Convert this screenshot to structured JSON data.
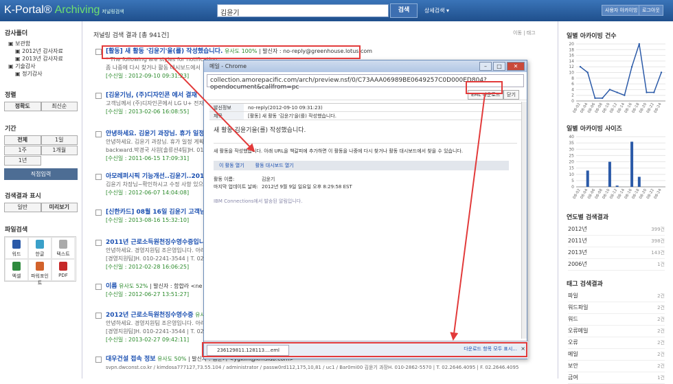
{
  "header": {
    "logo_kportal": "K-Portal®",
    "logo_archiving": "Archiving",
    "logo_sub": "저널링검색",
    "search_value": "김윤기",
    "search_button": "검색",
    "advanced_search": "상세검색 ▾",
    "my_archiving": "사용자 아카이빙",
    "logout": "로그아웃"
  },
  "left": {
    "audit_folder_title": "감사폴더",
    "tree": [
      "보관함",
      "2012년 감사자료",
      "2013년 감사자료",
      "기술감사",
      "정기감사"
    ],
    "sort_title": "정렬",
    "sort_options": [
      "정확도",
      "최신순"
    ],
    "period_title": "기간",
    "period_options": [
      "전체",
      "1일",
      "1주",
      "1개월",
      "1년"
    ],
    "direct_input": "직접입력",
    "display_title": "검색결과 표시",
    "display_options": [
      "일반",
      "미리보기"
    ],
    "file_search_title": "파일검색",
    "file_types": [
      "워드",
      "한글",
      "텍스트",
      "엑셀",
      "파워포인트",
      "PDF"
    ]
  },
  "main": {
    "title": "저널링 검색 결과",
    "count": "[총 941건]",
    "tool_move": "이동",
    "tool_tag": "태그",
    "results": [
      {
        "title": "[활동] 새 활동 '김윤기'을(를) 작성했습니다.",
        "sim": "유사도 100%",
        "sender": "발신자 : no-reply@greenhouse.lotus.com",
        "body": "* The following are styles for notification",
        "body2": "좀 나중에 다시 찾거나 활동 대시보드에서",
        "meta": "[수신일 : 2012-09-10 09:31:23]"
      },
      {
        "title": "[김윤기님, (주)디자인콘 에서 결재",
        "sim": "",
        "sender": "",
        "body": "고객님께서 (주)디자인콘에서 LG U+ 전자결",
        "body2": "",
        "meta": "[수신일 : 2013-02-06 16:08:55]"
      },
      {
        "title": "안녕하세요. 김윤기 과장님. 휴가 일정",
        "sim": "",
        "sender": "",
        "body": "안녕하세요. 김윤기 과장님. 휴가 일정 게획",
        "body2": "backward.박경국 사원[솔류션4팀]H. 010-",
        "meta": "[수신일 : 2011-06-15 17:09:31]"
      },
      {
        "title": "아모레퍼시픽 기능개선..김윤기..201206",
        "sim": "",
        "sender": "",
        "body": "김윤기 차장님~확인하시고 수정 사항 있으",
        "body2": "",
        "meta": "[수신일 : 2012-06-07 14:04:08]"
      },
      {
        "title": "[신한카드] 08월 16일 김윤기 고객님께",
        "sim": "",
        "sender": "",
        "body": "",
        "body2": "",
        "meta": "[수신일 : 2013-08-16 15:32:10]"
      },
      {
        "title": "2011년 근로소득원천징수영수증입니다.",
        "sim": "",
        "sender": "",
        "body": "안녕하세요. 경영지원팀 조은영입니다. 아래",
        "body2": "[경영지원팀]H. 010-2241-3544 | T. 02.264",
        "meta": "[수신일 : 2012-02-28 16:06:25]"
      },
      {
        "title": "이름",
        "sim": "유사도 52%",
        "sender": "발신자 : 함합라 <ne",
        "body": "",
        "body2": "",
        "meta": "[수신일 : 2012-06-27 13:51:27]"
      },
      {
        "title": "2012년 근로소득원천징수영수증",
        "sim": "유사",
        "sender": "",
        "body": "안녕하세요. 경영지원팀 조은영입니다. 아래",
        "body2": "[경영지원팀]H. 010-2241-3544 | T. 02.264",
        "meta": "[수신일 : 2013-02-27 09:42:11]"
      },
      {
        "title": "대우건설 접속 정보",
        "sim": "유사도 50%",
        "sender": "발신자 : 김윤기 <ygkim@kmslab.com>",
        "body": "svpn.dwconst.co.kr / kimdosa777127,73.55.104 / administrator / passw0rd112,175,10,81 / uc1 / Bar0mi00 김윤기 과장H. 010-2862-5570 | T. 02.2646.4095 | F. 02.2646.4095",
        "body2": "",
        "meta": ""
      }
    ]
  },
  "popup": {
    "title": "메일 - Chrome",
    "address": "collection.amorepacific.com/arch/preview.nsf/0/C73AAA06989BE0649257C0D000ED804?opendocument&callfrom=pc",
    "eml_download": "EML 다운로드",
    "close": "닫기",
    "sender_label": "발신정보",
    "sender_value": "no-reply(2012-09-10 09:31:23)",
    "subject_label": "제목",
    "subject_value": "[활동] 새 활동 '김윤기'을(를) 작성했습니다.",
    "headline": "새 활동 김윤기을(를) 작성했습니다.",
    "paragraph": "새 활동을 작성했습니다. 아래 URL을 책갈피에 추가하면 이 활동을 나중에 다시 찾거나 활동 대시보드에서 찾을 수 있습니다.",
    "tab_open": "이 활동 열기",
    "tab_dashboard": "활동 대시보드 열기",
    "activity_name_label": "활동 이름:",
    "activity_name_value": "김윤기",
    "last_update_label": "마지막 업데이트 날짜:",
    "last_update_value": "2012년 9월 9일 일요일 오후 8:29:58 EST",
    "footer_link": "IBM Connections에서 발송된 알림입니다.",
    "download_file": "236129811.128113....eml",
    "download_all": "다운로드 항목 모두 표시...",
    "download_close": "×"
  },
  "right": {
    "chart1_title": "일별 아카이빙 건수",
    "chart2_title": "일별 아카이빙 사이즈",
    "year_title": "연도별 검색결과",
    "years": [
      {
        "label": "2012년",
        "count": "399건"
      },
      {
        "label": "2011년",
        "count": "398건"
      },
      {
        "label": "2013년",
        "count": "143건"
      },
      {
        "label": "2006년",
        "count": "1건"
      }
    ],
    "tag_title": "태그 검색결과",
    "tags": [
      {
        "label": "파일",
        "count": "2건"
      },
      {
        "label": "워드파일",
        "count": "2건"
      },
      {
        "label": "워드",
        "count": "2건"
      },
      {
        "label": "오류메일",
        "count": "2건"
      },
      {
        "label": "오류",
        "count": "2건"
      },
      {
        "label": "메일",
        "count": "2건"
      },
      {
        "label": "보안",
        "count": "2건"
      },
      {
        "label": "금여",
        "count": "1건"
      }
    ]
  },
  "chart_data": [
    {
      "type": "line",
      "x": [
        "08-02",
        "08-04",
        "08-06",
        "08-08",
        "08-10",
        "08-12",
        "08-14",
        "08-16",
        "08-18",
        "08-20",
        "08-22",
        "08-24"
      ],
      "values": [
        12,
        10,
        1,
        1,
        4,
        3,
        2,
        12,
        20,
        3,
        3,
        10
      ],
      "ylim": [
        0,
        20
      ],
      "yticks": [
        0,
        2,
        4,
        6,
        8,
        10,
        12,
        14,
        16,
        18,
        20
      ]
    },
    {
      "type": "bar",
      "x": [
        "08-02",
        "08-04",
        "08-06",
        "08-08",
        "08-10",
        "08-12",
        "08-14",
        "08-16",
        "08-18",
        "08-20",
        "08-22",
        "08-24"
      ],
      "values": [
        0,
        13,
        0,
        0,
        20,
        1,
        0,
        36,
        8,
        0,
        0,
        0
      ],
      "ylim": [
        0,
        40
      ],
      "yticks": [
        0,
        5,
        10,
        15,
        20,
        25,
        30,
        35,
        40
      ]
    }
  ]
}
